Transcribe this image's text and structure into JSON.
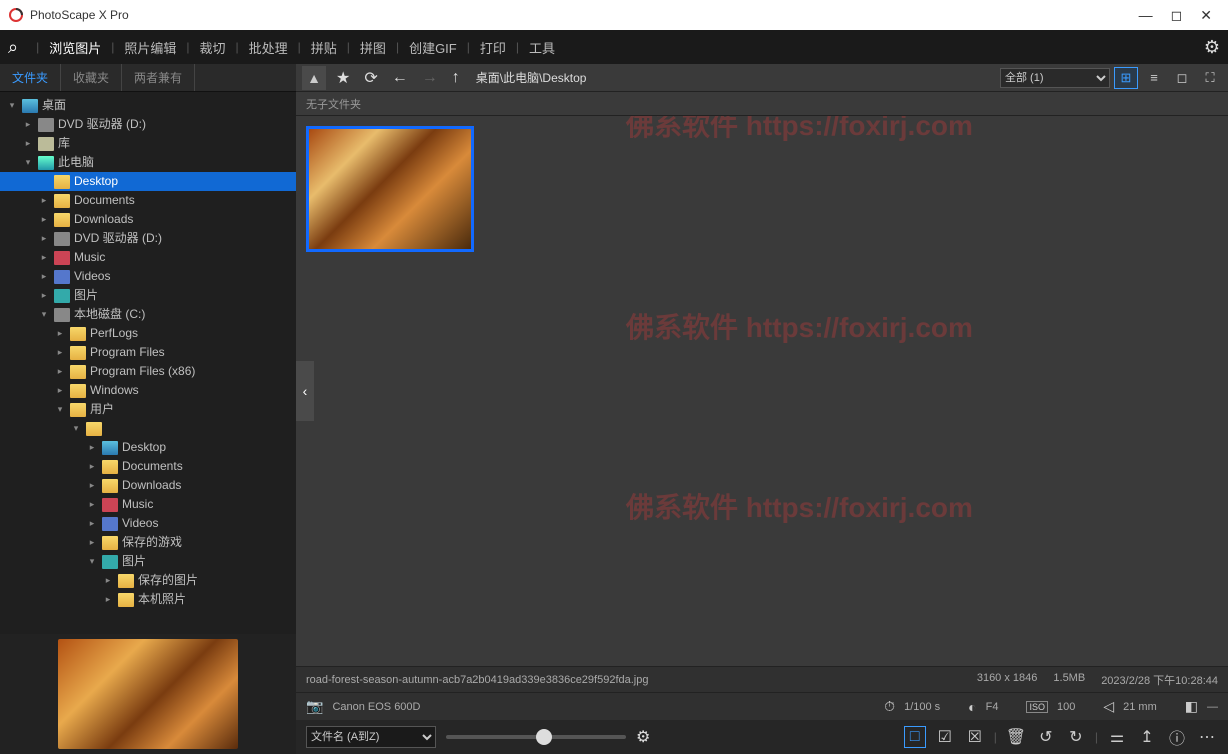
{
  "app": {
    "title": "PhotoScape X Pro"
  },
  "menu": {
    "items": [
      "浏览图片",
      "照片编辑",
      "裁切",
      "批处理",
      "拼贴",
      "拼图",
      "创建GIF",
      "打印",
      "工具"
    ],
    "active_index": 0
  },
  "sidebar_tabs": {
    "items": [
      "文件夹",
      "收藏夹",
      "两者兼有"
    ],
    "active_index": 0
  },
  "tree": [
    {
      "depth": 0,
      "expander": "v",
      "icon": "desktop",
      "label": "桌面",
      "sel": false
    },
    {
      "depth": 1,
      "expander": ">",
      "icon": "drive",
      "label": "DVD 驱动器 (D:)",
      "sel": false
    },
    {
      "depth": 1,
      "expander": ">",
      "icon": "lib",
      "label": "库",
      "sel": false
    },
    {
      "depth": 1,
      "expander": "v",
      "icon": "pc",
      "label": "此电脑",
      "sel": false
    },
    {
      "depth": 2,
      "expander": "",
      "icon": "folder",
      "label": "Desktop",
      "sel": true
    },
    {
      "depth": 2,
      "expander": ">",
      "icon": "folder",
      "label": "Documents",
      "sel": false
    },
    {
      "depth": 2,
      "expander": ">",
      "icon": "folder",
      "label": "Downloads",
      "sel": false
    },
    {
      "depth": 2,
      "expander": ">",
      "icon": "drive",
      "label": "DVD 驱动器 (D:)",
      "sel": false
    },
    {
      "depth": 2,
      "expander": ">",
      "icon": "music",
      "label": "Music",
      "sel": false
    },
    {
      "depth": 2,
      "expander": ">",
      "icon": "video",
      "label": "Videos",
      "sel": false
    },
    {
      "depth": 2,
      "expander": ">",
      "icon": "pic",
      "label": "图片",
      "sel": false
    },
    {
      "depth": 2,
      "expander": "v",
      "icon": "drive",
      "label": "本地磁盘 (C:)",
      "sel": false
    },
    {
      "depth": 3,
      "expander": ">",
      "icon": "folder",
      "label": "PerfLogs",
      "sel": false
    },
    {
      "depth": 3,
      "expander": ">",
      "icon": "folder",
      "label": "Program Files",
      "sel": false
    },
    {
      "depth": 3,
      "expander": ">",
      "icon": "folder",
      "label": "Program Files (x86)",
      "sel": false
    },
    {
      "depth": 3,
      "expander": ">",
      "icon": "folder",
      "label": "Windows",
      "sel": false
    },
    {
      "depth": 3,
      "expander": "v",
      "icon": "folder",
      "label": "用户",
      "sel": false
    },
    {
      "depth": 4,
      "expander": "v",
      "icon": "folder",
      "label": "",
      "sel": false
    },
    {
      "depth": 5,
      "expander": ">",
      "icon": "desktop",
      "label": "Desktop",
      "sel": false
    },
    {
      "depth": 5,
      "expander": ">",
      "icon": "folder",
      "label": "Documents",
      "sel": false
    },
    {
      "depth": 5,
      "expander": ">",
      "icon": "folder",
      "label": "Downloads",
      "sel": false
    },
    {
      "depth": 5,
      "expander": ">",
      "icon": "music",
      "label": "Music",
      "sel": false
    },
    {
      "depth": 5,
      "expander": ">",
      "icon": "video",
      "label": "Videos",
      "sel": false
    },
    {
      "depth": 5,
      "expander": ">",
      "icon": "folder",
      "label": "保存的游戏",
      "sel": false
    },
    {
      "depth": 5,
      "expander": "v",
      "icon": "pic",
      "label": "图片",
      "sel": false
    },
    {
      "depth": 6,
      "expander": ">",
      "icon": "folder",
      "label": "保存的图片",
      "sel": false
    },
    {
      "depth": 6,
      "expander": ">",
      "icon": "folder",
      "label": "本机照片",
      "sel": false
    }
  ],
  "toolbar": {
    "breadcrumb": "桌面\\此电脑\\Desktop",
    "filter_selected": "全部 (1)"
  },
  "sublabel": "无子文件夹",
  "fileinfo": {
    "filename": "road-forest-season-autumn-acb7a2b0419ad339e3836ce29f592fda.jpg",
    "dimensions": "3160 x 1846",
    "filesize": "1.5MB",
    "datetime": "2023/2/28 下午10:28:44"
  },
  "exif": {
    "camera": "Canon EOS 600D",
    "shutter": "1/100 s",
    "aperture": "F4",
    "iso": "100",
    "focal": "21 mm"
  },
  "bottom": {
    "sort_selected": "文件名 (A到Z)"
  },
  "watermark": "佛系软件 https://foxirj.com"
}
